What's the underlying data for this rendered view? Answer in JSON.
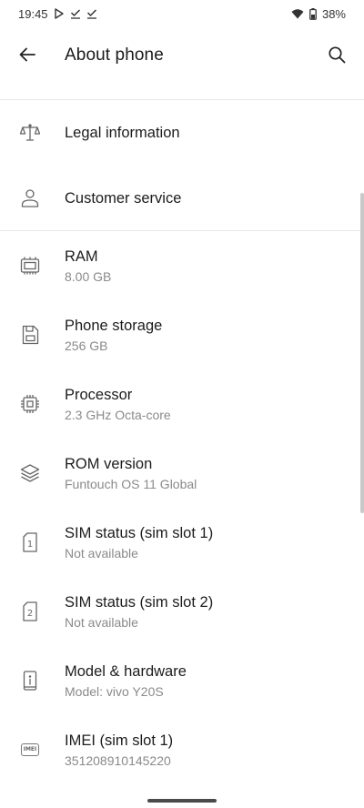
{
  "status_bar": {
    "time": "19:45",
    "battery": "38%",
    "icons": [
      "play-store-icon",
      "check-icon",
      "check-icon",
      "wifi-icon",
      "battery-icon"
    ]
  },
  "header": {
    "title": "About phone",
    "back_icon": "arrow-left-icon",
    "search_icon": "search-icon"
  },
  "items": [
    {
      "title": "Legal information",
      "subtitle": "",
      "icon": "scales-icon"
    },
    {
      "title": "Customer service",
      "subtitle": "",
      "icon": "person-icon"
    },
    {
      "title": "RAM",
      "subtitle": "8.00 GB",
      "icon": "ram-icon"
    },
    {
      "title": "Phone storage",
      "subtitle": "256 GB",
      "icon": "storage-icon"
    },
    {
      "title": "Processor",
      "subtitle": "2.3 GHz Octa-core",
      "icon": "cpu-icon"
    },
    {
      "title": "ROM version",
      "subtitle": "Funtouch OS 11 Global",
      "icon": "layers-icon"
    },
    {
      "title": "SIM status (sim slot 1)",
      "subtitle": "Not available",
      "icon": "sim1-icon"
    },
    {
      "title": "SIM status (sim slot 2)",
      "subtitle": "Not available",
      "icon": "sim2-icon"
    },
    {
      "title": "Model & hardware",
      "subtitle": "Model: vivo Y20S",
      "icon": "phone-info-icon"
    },
    {
      "title": "IMEI (sim slot 1)",
      "subtitle": "351208910145220",
      "icon": "imei-icon",
      "icon_text": "IMEI"
    }
  ]
}
